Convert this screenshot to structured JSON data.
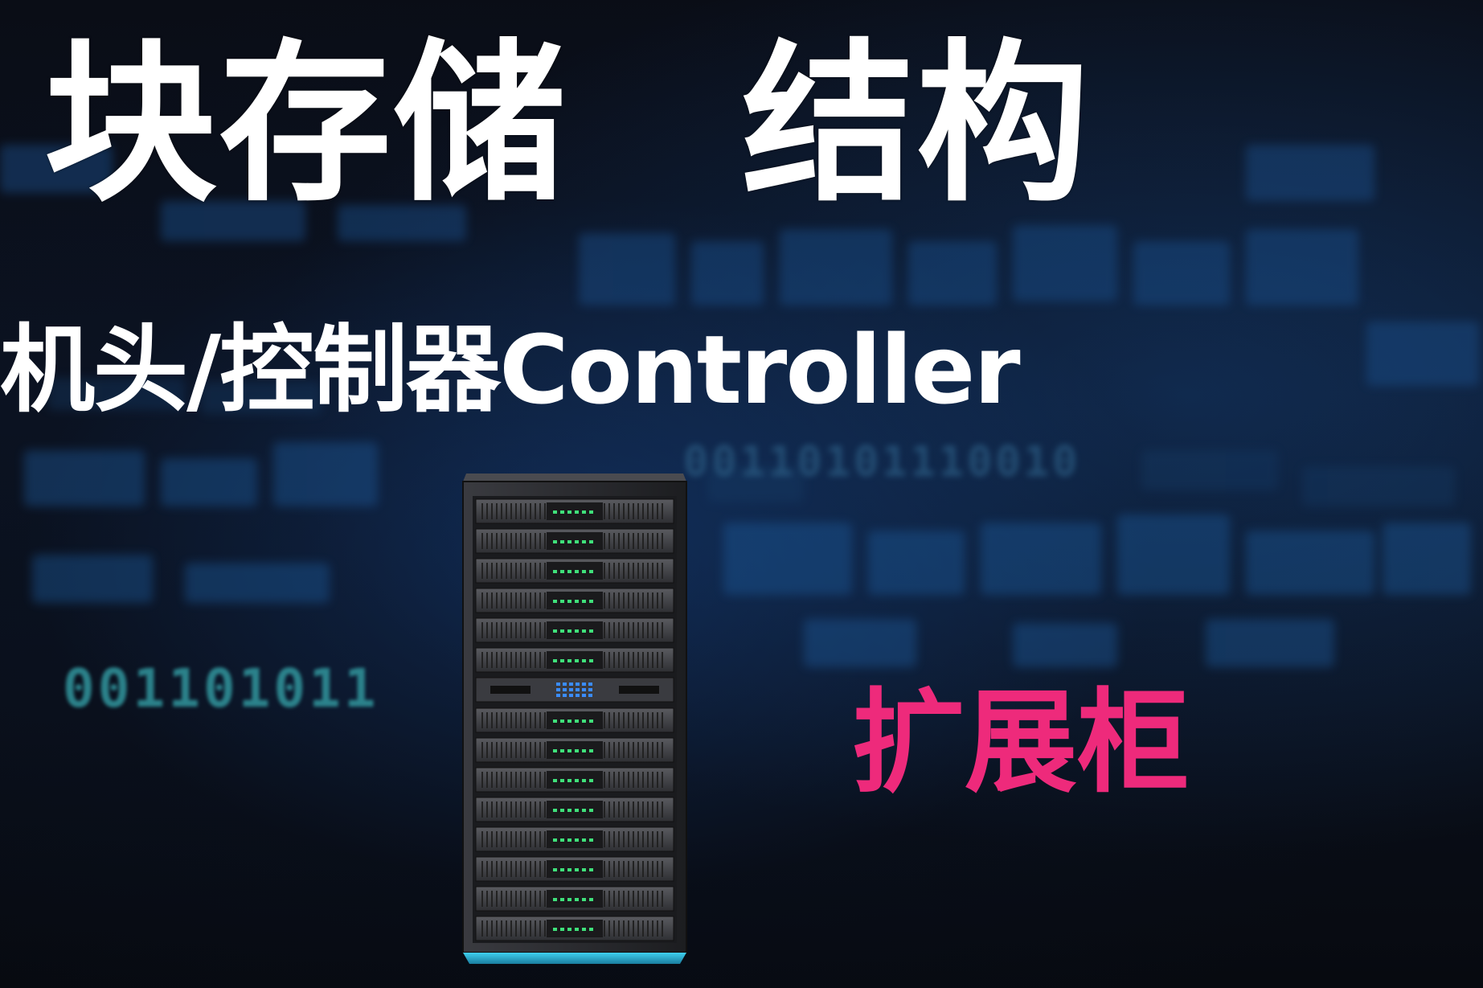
{
  "title": "块存储　结构",
  "subtitle": "机头/控制器Controller",
  "label": "扩展柜",
  "background_digits": [
    "001101011",
    "00110101110010"
  ],
  "colors": {
    "background": "#0a0e17",
    "title": "#ffffff",
    "label": "#ee2a7b",
    "digits": "#2f8e96",
    "rack_body": "#2a2a2d",
    "rack_base": "#2bb8d8",
    "led_green": "#3fe07a",
    "led_blue": "#3a8cff"
  },
  "icons": [
    "server-rack-icon"
  ]
}
